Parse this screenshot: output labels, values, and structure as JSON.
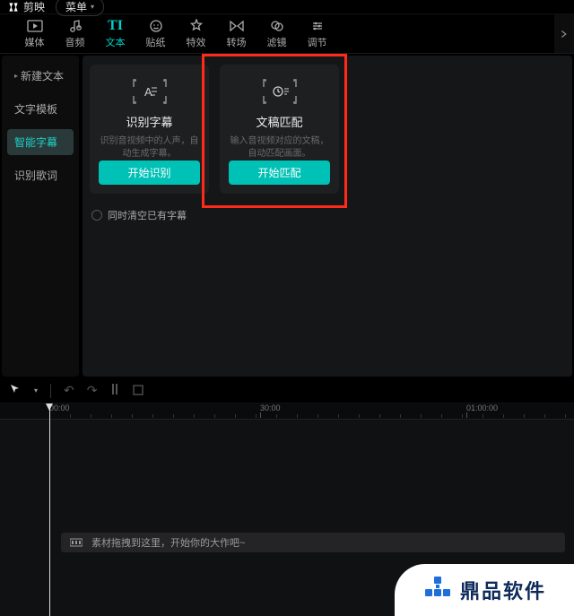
{
  "titlebar": {
    "app_name": "剪映",
    "menu_label": "菜单"
  },
  "tabs": [
    {
      "label": "媒体"
    },
    {
      "label": "音频"
    },
    {
      "label": "文本"
    },
    {
      "label": "贴纸"
    },
    {
      "label": "特效"
    },
    {
      "label": "转场"
    },
    {
      "label": "滤镜"
    },
    {
      "label": "调节"
    }
  ],
  "sidebar": {
    "items": [
      {
        "label": "新建文本"
      },
      {
        "label": "文字模板"
      },
      {
        "label": "智能字幕"
      },
      {
        "label": "识别歌词"
      }
    ]
  },
  "cards": {
    "recognize": {
      "title": "识别字幕",
      "desc": "识别音视频中的人声，自动生成字幕。",
      "button": "开始识别"
    },
    "match": {
      "title": "文稿匹配",
      "desc": "输入音视频对应的文稿，自动匹配画面。",
      "button": "开始匹配"
    }
  },
  "options": {
    "clear_existing": "同时清空已有字幕"
  },
  "timeline": {
    "ruler": [
      "00:00",
      "30:00",
      "01:00:00"
    ],
    "drop_hint": "素材拖拽到这里，开始你的大作吧~"
  },
  "watermark": {
    "text": "鼎品软件"
  },
  "colors": {
    "accent": "#00c1b5",
    "highlight": "#ff2a1a"
  }
}
